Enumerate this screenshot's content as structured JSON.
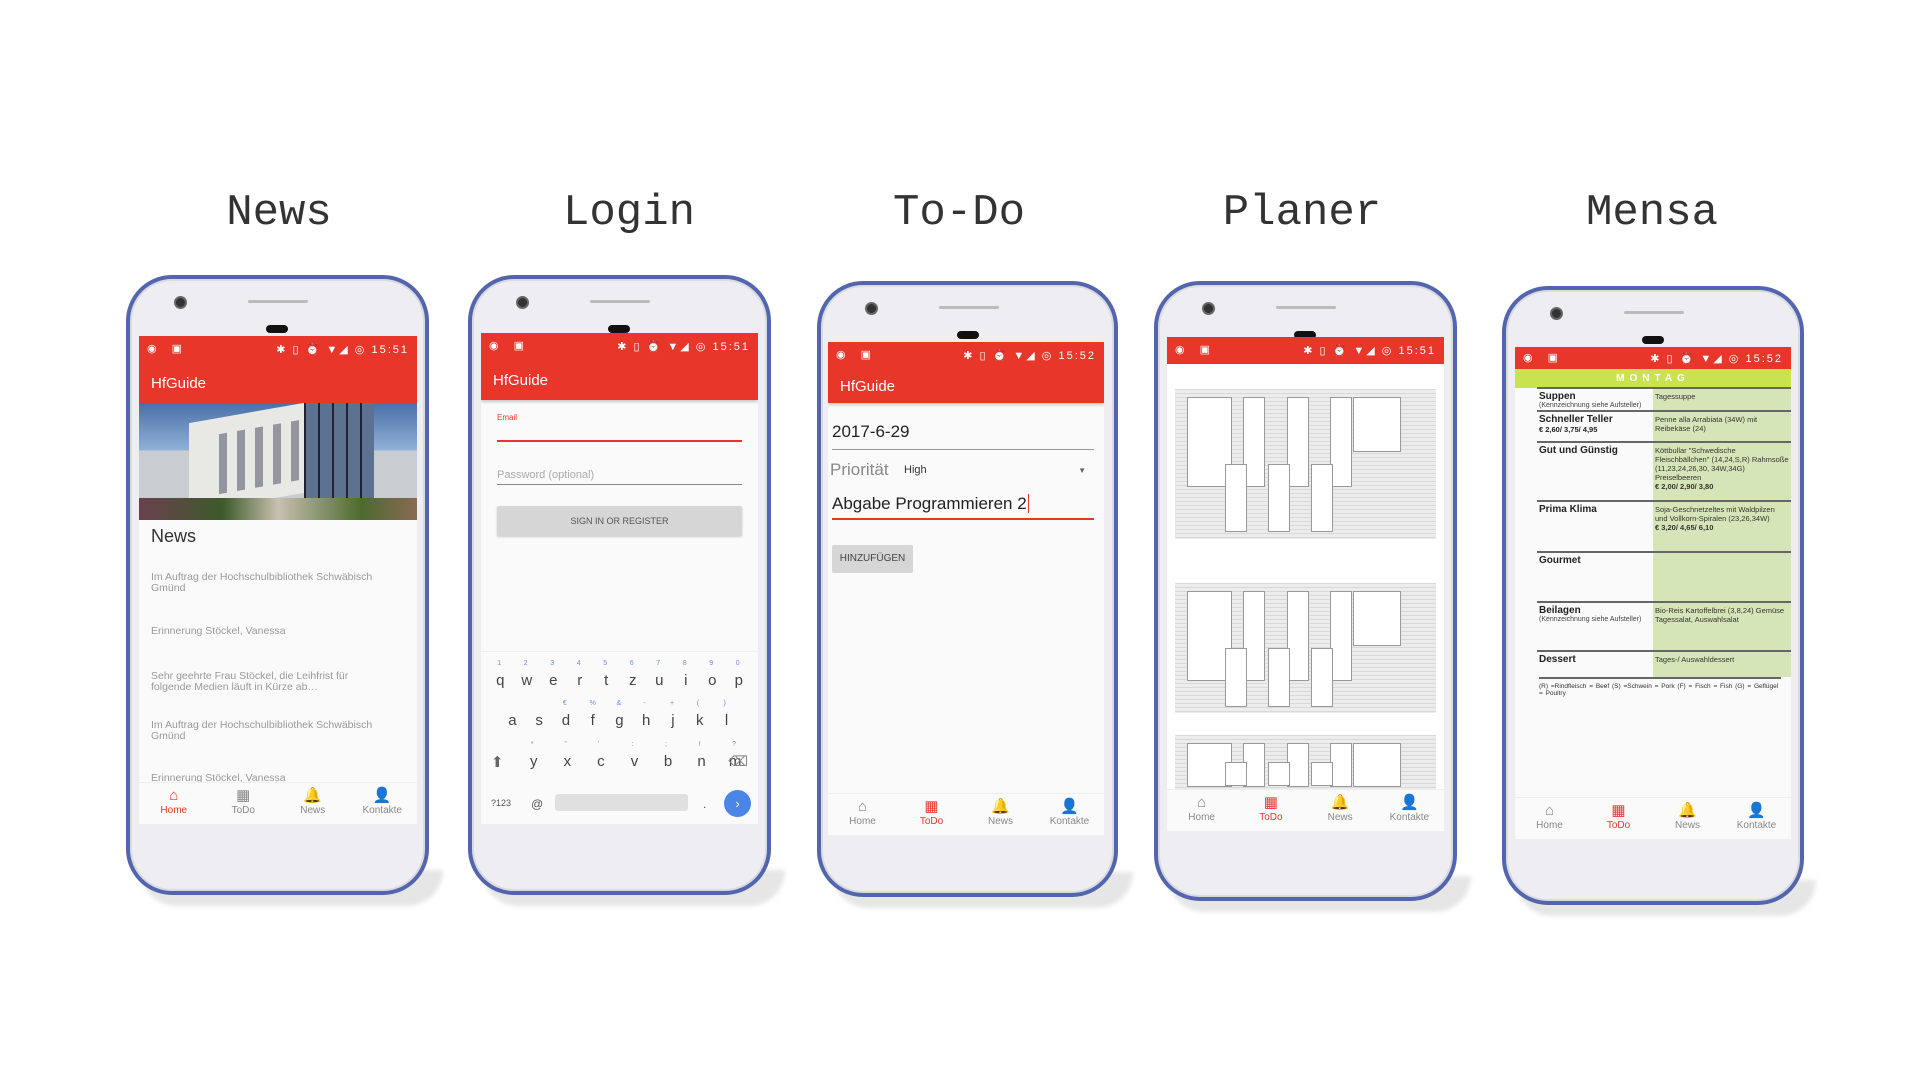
{
  "titles": [
    "News",
    "Login",
    "To-Do",
    "Planer",
    "Mensa"
  ],
  "app_title": "HfGuide",
  "status": {
    "left_icons": "◉ ▣",
    "right_icons": "✱ ▯ ⏰ ▼◢ ◎",
    "time_a": "15:51",
    "time_b": "15:52"
  },
  "nav": [
    {
      "label": "Home",
      "icon": "home-icon",
      "glyph": "⌂"
    },
    {
      "label": "ToDo",
      "icon": "dashboard-icon",
      "glyph": "▦"
    },
    {
      "label": "News",
      "icon": "bell-icon",
      "glyph": "🔔"
    },
    {
      "label": "Kontakte",
      "icon": "person-icon",
      "glyph": "👤"
    }
  ],
  "accent": "#e8372a",
  "news": {
    "heading": "News",
    "items": [
      "Im Auftrag der Hochschulbibliothek Schwäbisch Gmünd",
      "Erinnerung Stöckel, Vanessa",
      "Sehr geehrte Frau Stöckel, die Leihfrist für folgende Medien läuft in Kürze ab…",
      "Im Auftrag der Hochschulbibliothek Schwäbisch Gmünd",
      "Erinnerung Stöckel, Vanessa"
    ]
  },
  "login": {
    "email_label": "Email",
    "email_value": "",
    "password_placeholder": "Password (optional)",
    "button": "SIGN IN OR REGISTER",
    "keyboard": {
      "row1": [
        "q",
        "w",
        "e",
        "r",
        "t",
        "z",
        "u",
        "i",
        "o",
        "p"
      ],
      "row1_hints": [
        "1",
        "2",
        "3",
        "4",
        "5",
        "6",
        "7",
        "8",
        "9",
        "0"
      ],
      "row2": [
        "a",
        "s",
        "d",
        "f",
        "g",
        "h",
        "j",
        "k",
        "l"
      ],
      "row2_hints": [
        "",
        "",
        "€",
        "%",
        "&",
        "-",
        "+",
        "(",
        ")"
      ],
      "row3": [
        "y",
        "x",
        "c",
        "v",
        "b",
        "n",
        "m"
      ],
      "row3_hints": [
        "*",
        "\"",
        "'",
        ":",
        ";",
        "!",
        "?"
      ],
      "symbols": "?123",
      "at": "@",
      "period": "."
    }
  },
  "todo": {
    "date": "2017-6-29",
    "priority_label": "Priorität",
    "priority_value": "High",
    "task": "Abgabe Programmieren 2",
    "button": "HINZUFÜGEN"
  },
  "mensa": {
    "day": "MONTAG",
    "rows": [
      {
        "name": "Suppen",
        "sub": "(Kennzeichnung siehe Aufsteller)",
        "price": "",
        "dish": "Tagessuppe"
      },
      {
        "name": "Schneller Teller",
        "sub": "",
        "price": "€ 2,60/ 3,75/ 4,95",
        "dish": "Penne alla Arrabiata (34W) mit Reibekäse (24)"
      },
      {
        "name": "Gut und Günstig",
        "sub": "",
        "price": "",
        "dish": "Köttbullar \"Schwedische Fleischbällchen\" (14,24,S,R) Rahmsoße (11,23,24,26,30, 34W,34G) Preiselbeeren",
        "dish_price": "€ 2,00/ 2,90/ 3,80"
      },
      {
        "name": "Prima Klima",
        "sub": "",
        "price": "",
        "dish": "Soja-Geschnetzeltes mit Waldpilzen und Vollkorn-Spiralen (23,26,34W)",
        "dish_price": "€ 3,20/ 4,65/ 6,10"
      },
      {
        "name": "Gourmet",
        "sub": "",
        "price": "",
        "dish": ""
      },
      {
        "name": "Beilagen",
        "sub": "(Kennzeichnung siehe Aufsteller)",
        "price": "",
        "dish": "Bio-Reis Kartoffelbrei (3,8,24) Gemüse Tagessalat, Auswahlsalat"
      },
      {
        "name": "Dessert",
        "sub": "",
        "price": "",
        "dish": "Tages-/ Auswahldessert"
      }
    ],
    "legend": "(R) =Rindfleisch = Beef   (S) =Schwein = Pork   (F) = Fisch = Fish   (G) = Geflügel = Poultry"
  }
}
